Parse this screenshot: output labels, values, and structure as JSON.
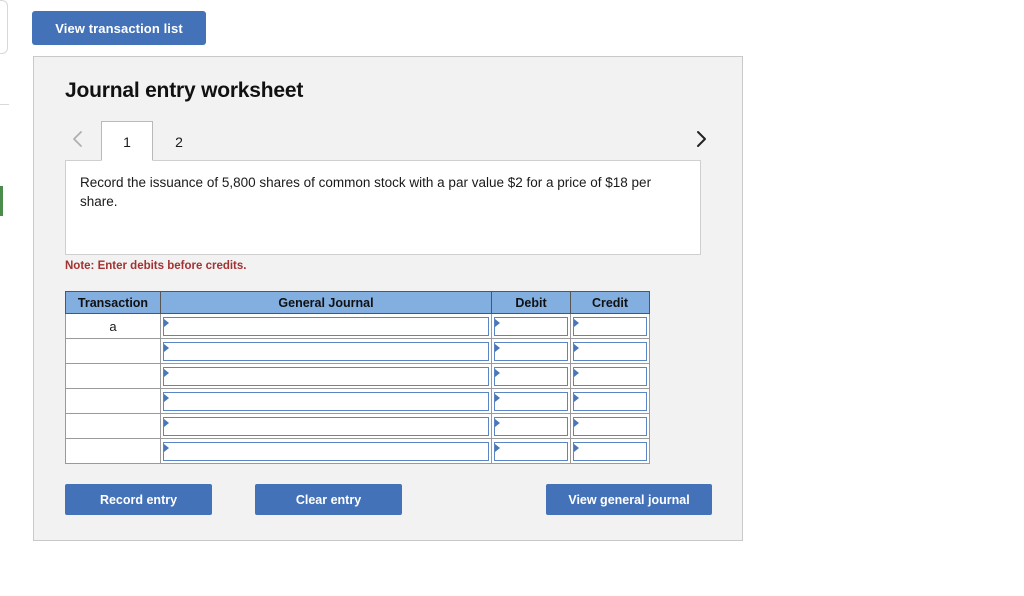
{
  "edge": {
    "card_sliver": "clipped-card",
    "green_sliver_color": "#4b8b4b"
  },
  "toolbar": {
    "view_transaction_label": "View transaction list"
  },
  "worksheet": {
    "title": "Journal entry worksheet",
    "nav": {
      "prev_icon": "chevron-left-icon",
      "next_icon": "chevron-right-icon",
      "prev_enabled": false,
      "next_enabled": true
    },
    "tabs": [
      {
        "label": "1",
        "active": true
      },
      {
        "label": "2",
        "active": false
      }
    ],
    "prompt": "Record the issuance of 5,800 shares of common stock with a par value $2 for a price of $18 per share.",
    "note": "Note: Enter debits before credits."
  },
  "table": {
    "columns": [
      "Transaction",
      "General Journal",
      "Debit",
      "Credit"
    ],
    "rows": [
      {
        "transaction": "a",
        "general_journal": "",
        "debit": "",
        "credit": ""
      },
      {
        "transaction": "",
        "general_journal": "",
        "debit": "",
        "credit": ""
      },
      {
        "transaction": "",
        "general_journal": "",
        "debit": "",
        "credit": ""
      },
      {
        "transaction": "",
        "general_journal": "",
        "debit": "",
        "credit": ""
      },
      {
        "transaction": "",
        "general_journal": "",
        "debit": "",
        "credit": ""
      },
      {
        "transaction": "",
        "general_journal": "",
        "debit": "",
        "credit": ""
      }
    ]
  },
  "actions": {
    "record_label": "Record entry",
    "clear_label": "Clear entry",
    "view_journal_label": "View general journal"
  },
  "colors": {
    "button_blue": "#4472b8",
    "header_blue": "#82aee0",
    "field_border_blue": "#5b85c5",
    "note_red": "#a33232",
    "panel_gray": "#f2f2f2"
  }
}
